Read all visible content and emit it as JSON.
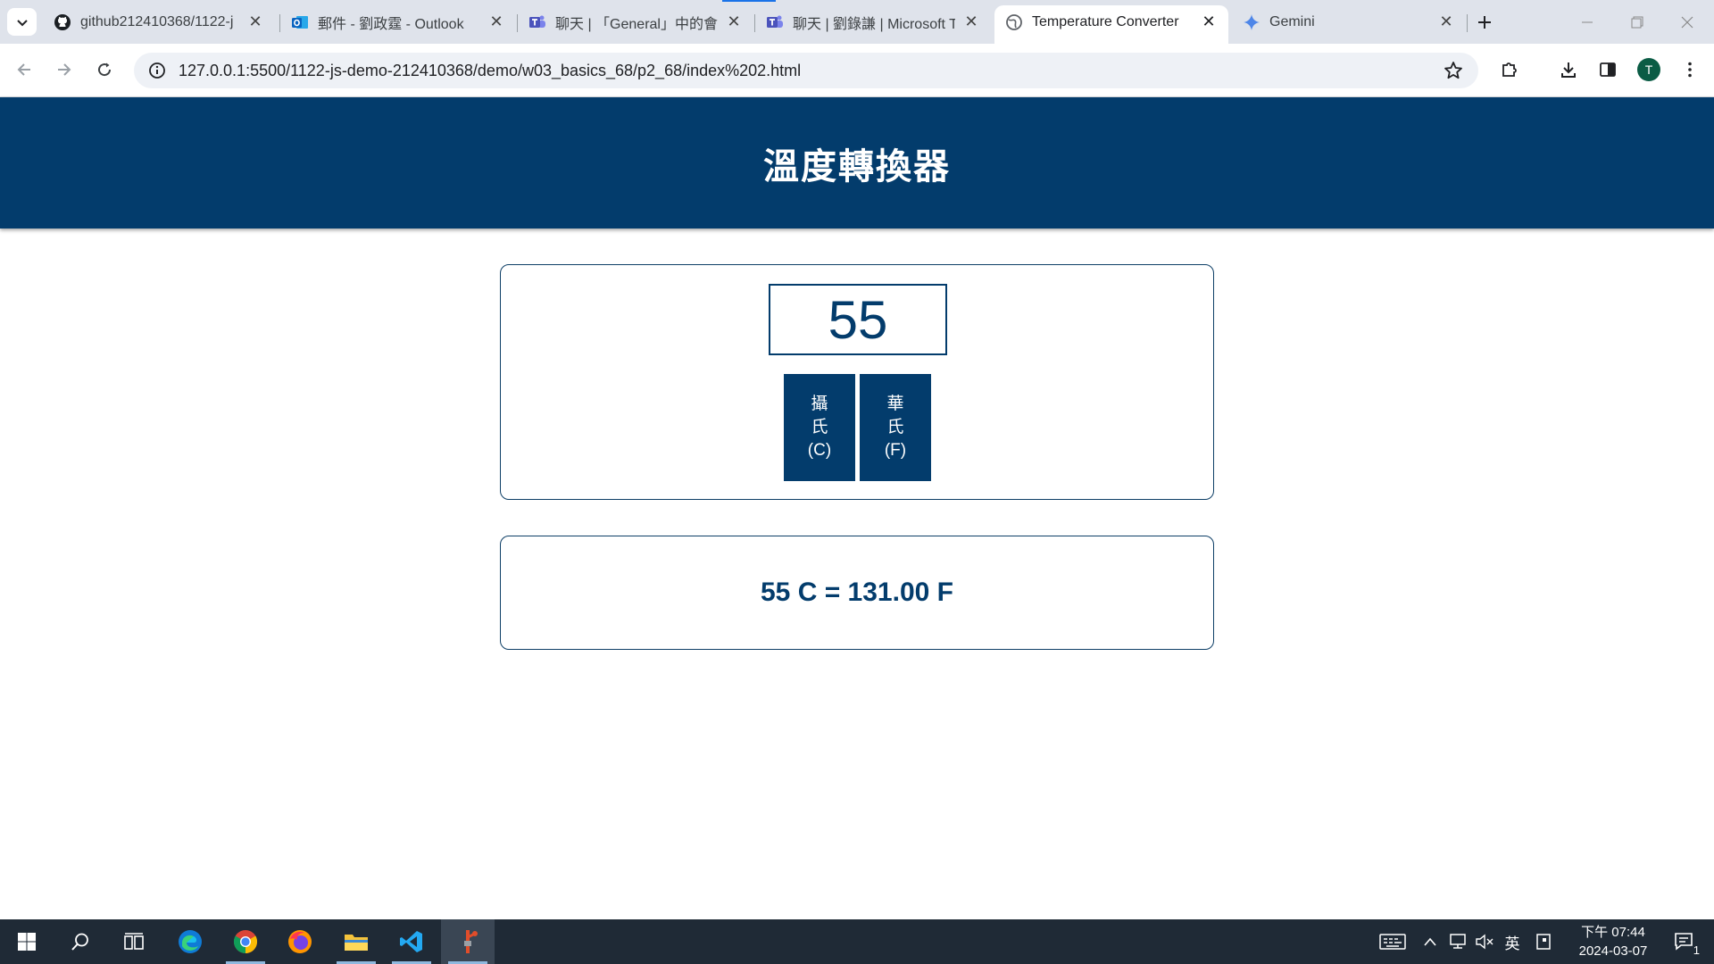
{
  "browser": {
    "tabs": [
      {
        "title": "github212410368/1122-j",
        "icon": "github-icon",
        "active": false
      },
      {
        "title": "郵件 - 劉政霆 - Outlook",
        "icon": "outlook-icon",
        "active": false
      },
      {
        "title": "聊天 | 「General」中的會議",
        "icon": "teams-icon",
        "active": false
      },
      {
        "title": "聊天 | 劉錄謙 | Microsoft T",
        "icon": "teams-icon",
        "active": false
      },
      {
        "title": "Temperature Converter",
        "icon": "globe-icon",
        "active": true
      },
      {
        "title": "Gemini",
        "icon": "gemini-icon",
        "active": false
      }
    ],
    "url": "127.0.0.1:5500/1122-js-demo-212410368/demo/w03_basics_68/p2_68/index%202.html",
    "profile_initial": "T"
  },
  "page": {
    "title": "溫度轉換器",
    "input_value": "55",
    "buttons": {
      "celsius": {
        "line1": "攝",
        "line2": "氏",
        "line3": "(C)"
      },
      "fahrenheit": {
        "line1": "華",
        "line2": "氏",
        "line3": "(F)"
      }
    },
    "result": "55 C = 131.00 F"
  },
  "taskbar": {
    "apps": [
      "windows-start-icon",
      "search-icon",
      "task-view-icon",
      "edge-icon",
      "chrome-icon",
      "firefox-icon",
      "file-explorer-icon",
      "vscode-icon",
      "git-icon"
    ],
    "ime_label": "英",
    "clock_period_time": "下午 07:44",
    "clock_date": "2024-03-07",
    "notification_count": "1"
  },
  "colors": {
    "primary": "#033c6c",
    "taskbar": "#1f2a36",
    "tabstrip": "#dfe3eb"
  }
}
